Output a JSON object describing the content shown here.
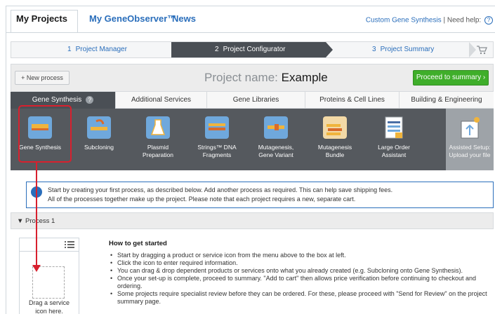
{
  "top_nav": {
    "tabs": [
      "My Projects",
      "My GeneObserver™",
      "News"
    ],
    "custom_link": "Custom Gene Synthesis",
    "separator": " | ",
    "need_help": "Need help:",
    "help_icon": "?"
  },
  "stepper": {
    "steps": [
      {
        "num": "1",
        "label": "Project Manager"
      },
      {
        "num": "2",
        "label": "Project Configurator"
      },
      {
        "num": "3",
        "label": "Project Summary"
      }
    ],
    "cart_icon": "cart-icon"
  },
  "project_bar": {
    "new_process": "+ New process",
    "name_prefix": "Project name: ",
    "name_value": "Example",
    "summary_button": "Proceed to summary ›"
  },
  "category_tabs": [
    "Gene Synthesis",
    "Additional Services",
    "Gene Libraries",
    "Proteins & Cell Lines",
    "Building & Engineering"
  ],
  "products": [
    {
      "line1": "Gene Synthesis",
      "line2": ""
    },
    {
      "line1": "Subcloning",
      "line2": ""
    },
    {
      "line1": "Plasmid",
      "line2": "Preparation"
    },
    {
      "line1": "Strings™ DNA",
      "line2": "Fragments"
    },
    {
      "line1": "Mutagenesis,",
      "line2": "Gene Variant"
    },
    {
      "line1": "Mutagenesis",
      "line2": "Bundle"
    },
    {
      "line1": "Large Order",
      "line2": "Assistant"
    },
    {
      "line1": "Assisted Setup:",
      "line2": "Upload your file"
    }
  ],
  "info": {
    "line1": "Start by creating your first process, as described below. Add another process as required. This can help save shipping fees.",
    "line2": "All of the processes together make up the project. Please note that each project requires a new, separate cart."
  },
  "process": {
    "header": "▼ Process 1",
    "drag_label_1": "Drag a service",
    "drag_label_2": "icon here."
  },
  "how_to": {
    "title": "How to get started",
    "items": [
      "Start by dragging a product or service icon from the menu above to the box at left.",
      "Click the icon to enter required information.",
      "You can drag & drop dependent products or services onto what you already created (e.g. Subcloning onto Gene Synthesis).",
      "Once your set-up is complete, proceed to summary. \"Add to cart\" then allows price verification before continuing to checkout and ordering.",
      "Some projects require specialist review before they can be ordered. For these, please proceed with \"Send for Review\" on the project summary page."
    ]
  },
  "colors": {
    "accent_blue": "#2a6ebb",
    "proceed_green": "#3fae2a",
    "highlight_red": "#d8202e",
    "dark_strip": "#55595e"
  }
}
